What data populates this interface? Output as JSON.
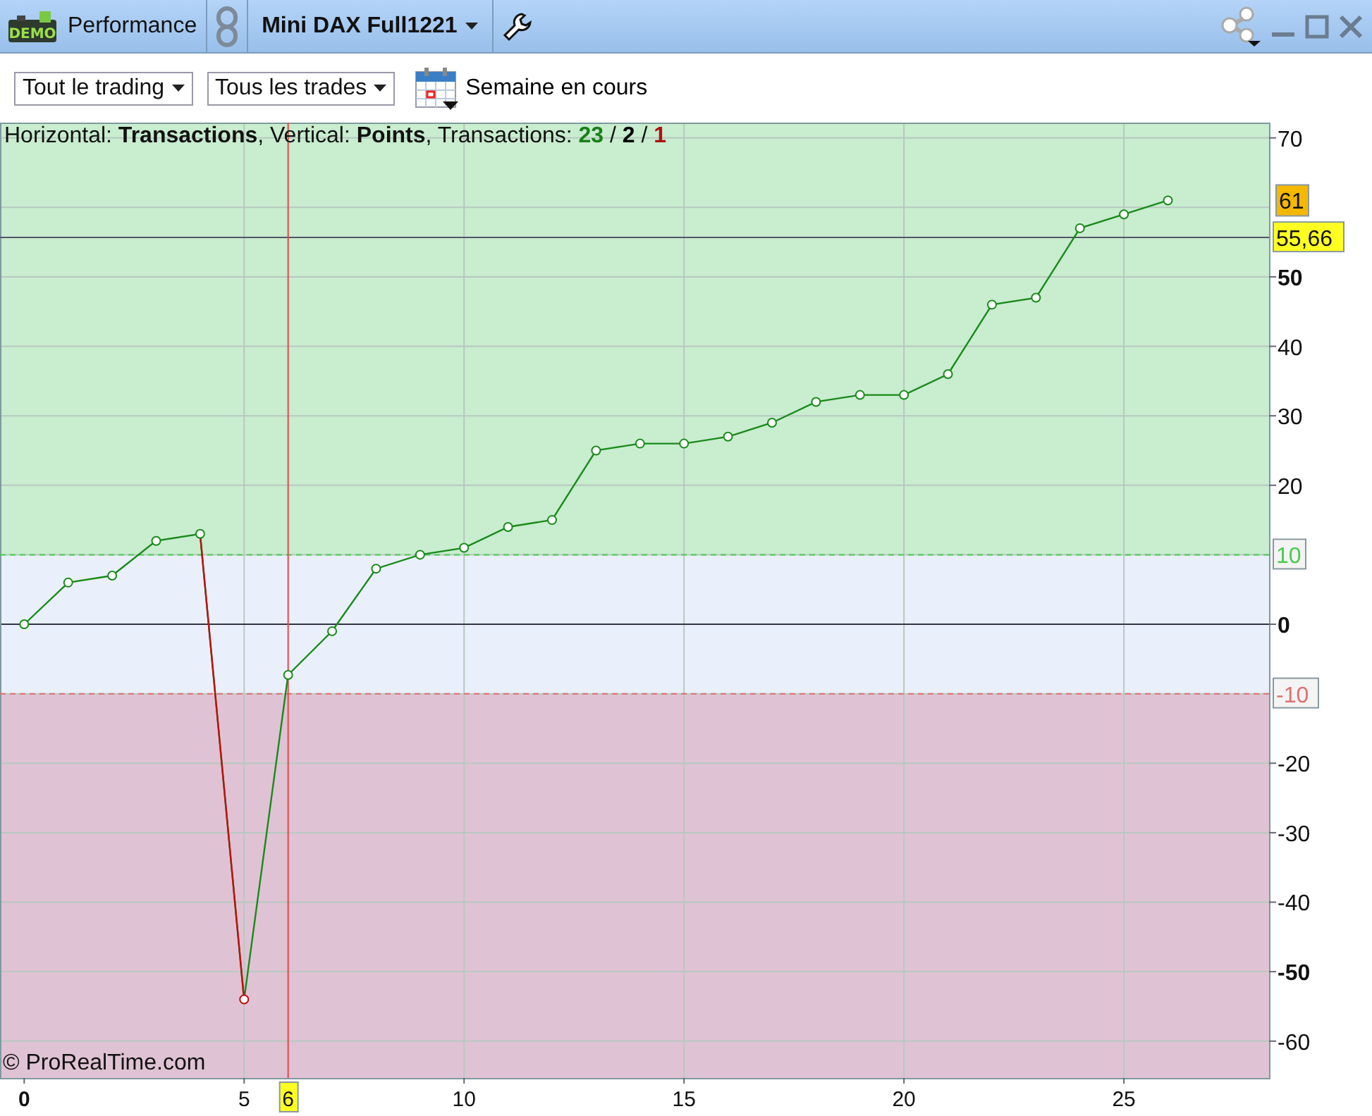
{
  "window": {
    "badge": "DEMO",
    "title": "Performance",
    "instrument": "Mini DAX Full1221"
  },
  "toolbar": {
    "dropdowns": [
      "Tout le trading",
      "Tous les trades"
    ],
    "period": "Semaine en cours"
  },
  "info": {
    "text": "Horizontal: **Transactions**, Vertical: **Points**, Transactions: ",
    "separator": "/",
    "counts": [
      {
        "text": "23",
        "color": "#1a7f1a"
      },
      {
        "text": "2",
        "color": "#000000"
      },
      {
        "text": "1",
        "color": "#b01010"
      }
    ]
  },
  "copyright": "© ProRealTime.com",
  "chart": {
    "chart_data": {
      "type": "line",
      "x": [
        0,
        1,
        2,
        3,
        4,
        5,
        6,
        7,
        8,
        9,
        10,
        11,
        12,
        13,
        14,
        15,
        16,
        17,
        18,
        19,
        20,
        21,
        22,
        23,
        24,
        25,
        26
      ],
      "series": [
        {
          "color": "#1a8a1a",
          "marker": "o",
          "values": [
            0,
            6,
            7,
            12,
            13,
            -54,
            -7.3,
            -1,
            8,
            10,
            11,
            14,
            15,
            25,
            26,
            26,
            27,
            29,
            32,
            33,
            33,
            36,
            46,
            47,
            57,
            59,
            61
          ]
        },
        {
          "color": "#c01010",
          "marker": "o",
          "values": [
            null,
            null,
            null,
            null,
            13,
            -54,
            null,
            null,
            null,
            null,
            null,
            null,
            null,
            null,
            null,
            null,
            null,
            null,
            null,
            null,
            null,
            null,
            null,
            null,
            null,
            null,
            null
          ]
        }
      ],
      "xlim": [
        -0.55,
        28.3
      ],
      "ylim": [
        -65.3,
        72.2
      ],
      "grid": true,
      "xticks": [
        {
          "value": 0,
          "label": "0"
        },
        {
          "value": 5,
          "label": "5"
        },
        {
          "value": 10,
          "label": "10"
        },
        {
          "value": 15,
          "label": "15"
        },
        {
          "value": 20,
          "label": "20"
        },
        {
          "value": 25,
          "label": "25"
        }
      ],
      "yticks": [
        {
          "value": 70,
          "label": "70"
        },
        {
          "value": 50,
          "label": "50"
        },
        {
          "value": 40,
          "label": "40"
        },
        {
          "value": 30,
          "label": "30"
        },
        {
          "value": 20,
          "label": "20"
        },
        {
          "value": 0,
          "label": "0"
        },
        {
          "value": -20,
          "label": "-20"
        },
        {
          "value": -30,
          "label": "-30"
        },
        {
          "value": -40,
          "label": "-40"
        },
        {
          "value": -50,
          "label": "-50"
        },
        {
          "value": -60,
          "label": "-60"
        }
      ],
      "bands": [
        {
          "axis": "y",
          "from": 10,
          "to": 72.2,
          "color": "#c8edcf"
        },
        {
          "axis": "y",
          "from": -10,
          "to": 10,
          "color": "#e9f0fc"
        },
        {
          "axis": "y",
          "from": -65.3,
          "to": -10,
          "color": "#dfc3d4"
        }
      ],
      "ref_lines": [
        {
          "axis": "y",
          "value": 10,
          "label": "10",
          "color": "#4ccc4c"
        },
        {
          "axis": "y",
          "value": -10,
          "label": "-10",
          "color": "#e07070"
        },
        {
          "axis": "y",
          "value": 55.66,
          "label": "55,66",
          "color": "#555566"
        },
        {
          "axis": "x",
          "value": 6,
          "label": "6",
          "color": "#ee4444"
        }
      ],
      "annotations": [
        "61"
      ]
    }
  }
}
